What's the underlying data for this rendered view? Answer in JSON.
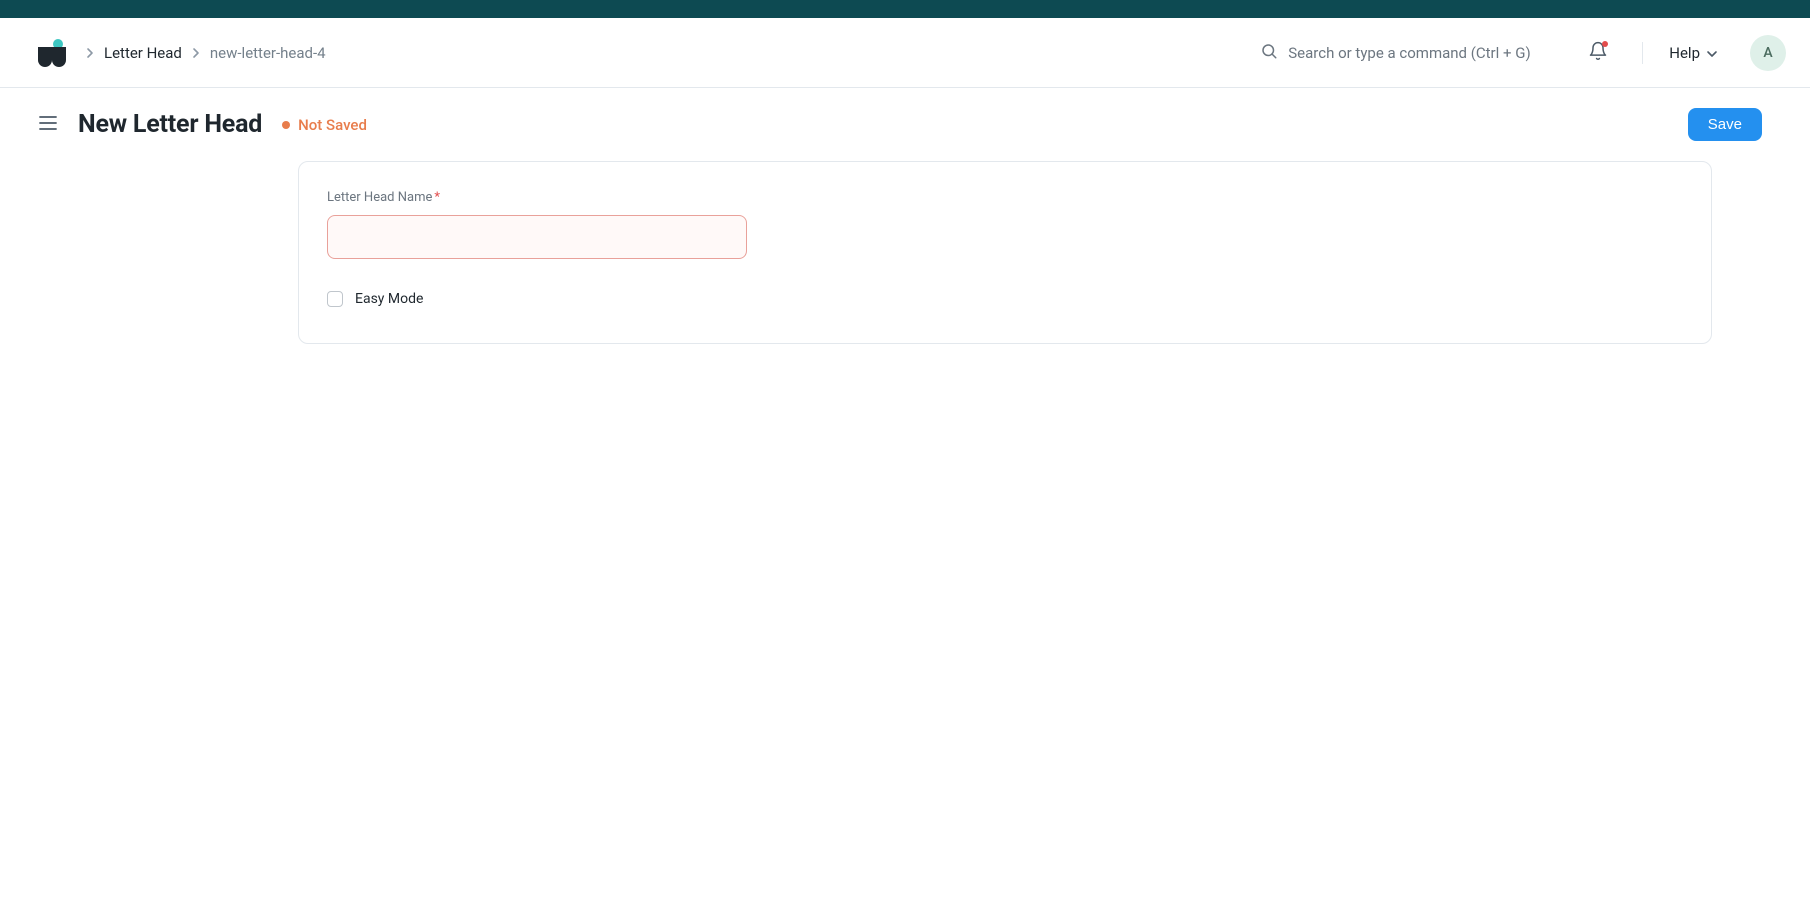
{
  "breadcrumb": {
    "parent": "Letter Head",
    "current": "new-letter-head-4"
  },
  "topbar": {
    "search_placeholder": "Search or type a command (Ctrl + G)",
    "help_label": "Help",
    "avatar_initial": "A"
  },
  "header": {
    "title": "New Letter Head",
    "status_label": "Not Saved",
    "save_label": "Save"
  },
  "form": {
    "name_label": "Letter Head Name",
    "name_value": "",
    "easy_mode_label": "Easy Mode",
    "easy_mode_checked": false
  }
}
